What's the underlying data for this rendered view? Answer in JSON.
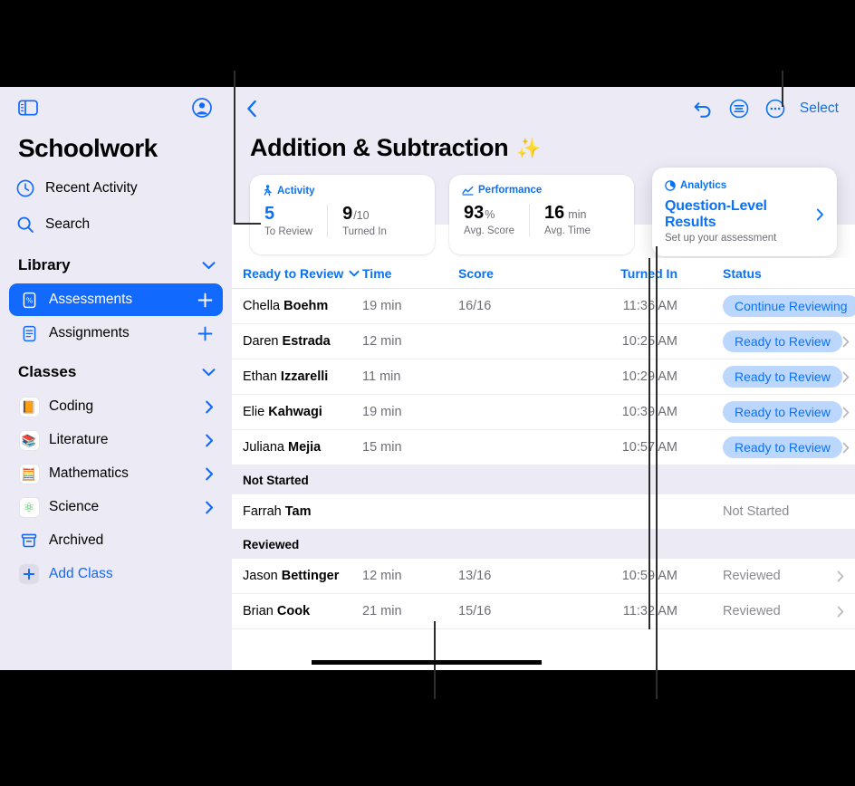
{
  "sidebar": {
    "toolbar": {
      "toggle_icon": "sidebar-toggle-icon",
      "account_icon": "account-circle-icon"
    },
    "app_title": "Schoolwork",
    "top_items": [
      {
        "label": "Recent Activity",
        "icon": "clock-icon"
      },
      {
        "label": "Search",
        "icon": "search-icon"
      }
    ],
    "library": {
      "header": "Library",
      "items": [
        {
          "label": "Assessments",
          "icon": "percent-doc-icon",
          "selected": true,
          "trailing": "plus-icon"
        },
        {
          "label": "Assignments",
          "icon": "document-icon",
          "selected": false,
          "trailing": "plus-icon"
        }
      ]
    },
    "classes": {
      "header": "Classes",
      "items": [
        {
          "label": "Coding",
          "glyph": "📙",
          "color": "#f5921e",
          "trailing": "chevron-right-icon"
        },
        {
          "label": "Literature",
          "glyph": "📚",
          "color": "#a33bdc",
          "trailing": "chevron-right-icon"
        },
        {
          "label": "Mathematics",
          "glyph": "🧮",
          "color": "#2f9fe0",
          "trailing": "chevron-right-icon"
        },
        {
          "label": "Science",
          "glyph": "⚛",
          "color": "#35ba44",
          "trailing": "chevron-right-icon"
        }
      ],
      "archived": {
        "label": "Archived",
        "icon": "archive-box-icon"
      },
      "add_class": {
        "label": "Add Class",
        "icon": "plus-icon"
      }
    }
  },
  "main": {
    "toolbar": {
      "back_icon": "chevron-left-icon",
      "undo_icon": "undo-arrow-icon",
      "filter_icon": "filter-lines-circle-icon",
      "more_icon": "ellipsis-circle-icon",
      "select_label": "Select"
    },
    "title": "Addition & Subtraction",
    "title_emoji": "✨",
    "cards": [
      {
        "id": "activity",
        "head": "Activity",
        "head_icon": "walking-figure-icon",
        "metrics": [
          {
            "value": "5",
            "suffix": "",
            "caption": "To Review",
            "accent": true
          },
          {
            "value": "9",
            "suffix": "/10",
            "caption": "Turned In",
            "accent": false
          }
        ]
      },
      {
        "id": "performance",
        "head": "Performance",
        "head_icon": "line-chart-icon",
        "metrics": [
          {
            "value": "93",
            "suffix": "%",
            "caption": "Avg. Score",
            "accent": false
          },
          {
            "value": "16",
            "suffix": "min",
            "caption": "Avg. Time",
            "accent": false
          }
        ]
      },
      {
        "id": "analytics",
        "head": "Analytics",
        "head_icon": "pie-clock-icon",
        "link_title": "Question-Level Results",
        "link_sub": "Set up your assessment",
        "chevron": "chevron-right-icon"
      }
    ],
    "table": {
      "columns": {
        "name": "Ready to Review",
        "name_sort_icon": "chevron-down-icon",
        "time": "Time",
        "score": "Score",
        "turned_in": "Turned In",
        "status": "Status"
      },
      "rows": [
        {
          "type": "row",
          "first": "Chella",
          "last": "Boehm",
          "time": "19 min",
          "score": "16/16",
          "turned_in": "11:36 AM",
          "status": "Continue Reviewing",
          "status_style": "pill",
          "chevron": true
        },
        {
          "type": "row",
          "first": "Daren",
          "last": "Estrada",
          "time": "12 min",
          "score": "",
          "turned_in": "10:25 AM",
          "status": "Ready to Review",
          "status_style": "pill",
          "chevron": true
        },
        {
          "type": "row",
          "first": "Ethan",
          "last": "Izzarelli",
          "time": "11 min",
          "score": "",
          "turned_in": "10:29 AM",
          "status": "Ready to Review",
          "status_style": "pill",
          "chevron": true
        },
        {
          "type": "row",
          "first": "Elie",
          "last": "Kahwagi",
          "time": "19 min",
          "score": "",
          "turned_in": "10:39 AM",
          "status": "Ready to Review",
          "status_style": "pill",
          "chevron": true
        },
        {
          "type": "row",
          "first": "Juliana",
          "last": "Mejia",
          "time": "15 min",
          "score": "",
          "turned_in": "10:57 AM",
          "status": "Ready to Review",
          "status_style": "pill",
          "chevron": true
        },
        {
          "type": "section",
          "label": "Not Started"
        },
        {
          "type": "row",
          "first": "Farrah",
          "last": "Tam",
          "time": "",
          "score": "",
          "turned_in": "",
          "status": "Not Started",
          "status_style": "plain",
          "chevron": false
        },
        {
          "type": "section",
          "label": "Reviewed"
        },
        {
          "type": "row",
          "first": "Jason",
          "last": "Bettinger",
          "time": "12 min",
          "score": "13/16",
          "turned_in": "10:59 AM",
          "status": "Reviewed",
          "status_style": "plain",
          "chevron": true
        },
        {
          "type": "row",
          "first": "Brian",
          "last": "Cook",
          "time": "21 min",
          "score": "15/16",
          "turned_in": "11:32 AM",
          "status": "Reviewed",
          "status_style": "plain",
          "chevron": true
        }
      ]
    }
  },
  "colors": {
    "accent_blue": "#0b72f5",
    "selected_blue": "#1269fd",
    "pill_bg": "#bcd7fd",
    "sidebar_bg": "#eceaf4",
    "muted_text": "#6e6e76"
  }
}
